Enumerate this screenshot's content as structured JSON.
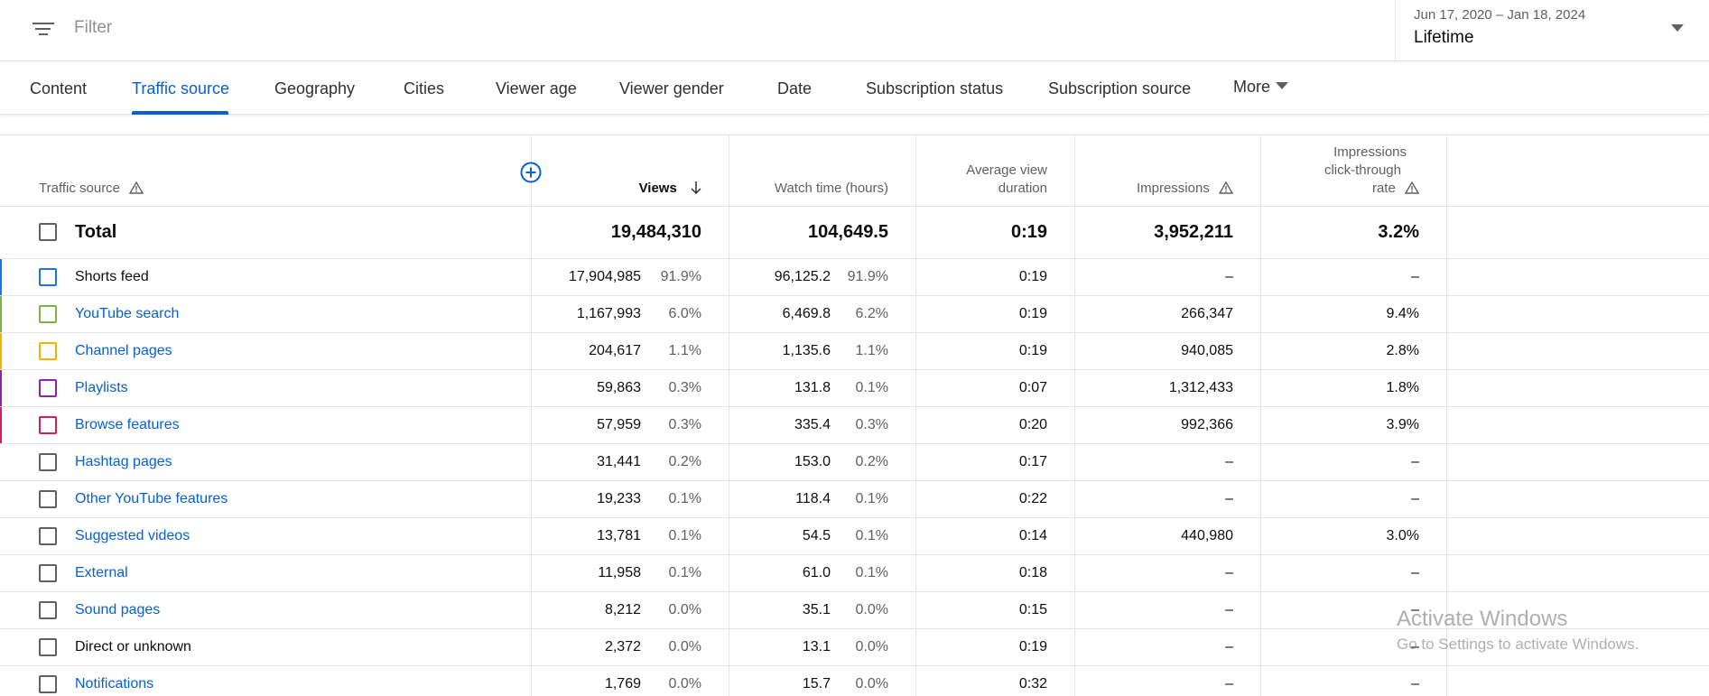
{
  "filter": {
    "placeholder": "Filter"
  },
  "date_range": {
    "dates": "Jun 17, 2020 – Jan 18, 2024",
    "label": "Lifetime"
  },
  "tabs": [
    {
      "label": "Content"
    },
    {
      "label": "Traffic source",
      "active": true
    },
    {
      "label": "Geography"
    },
    {
      "label": "Cities"
    },
    {
      "label": "Viewer age"
    },
    {
      "label": "Viewer gender"
    },
    {
      "label": "Date"
    },
    {
      "label": "Subscription status"
    },
    {
      "label": "Subscription source"
    },
    {
      "label": "More"
    }
  ],
  "columns": {
    "source": "Traffic source",
    "views": "Views",
    "watch_time": "Watch time (hours)",
    "avg_duration_1": "Average view",
    "avg_duration_2": "duration",
    "impressions": "Impressions",
    "ctr_1": "Impressions",
    "ctr_2": "click-through",
    "ctr_3": "rate"
  },
  "total": {
    "label": "Total",
    "views": "19,484,310",
    "watch_time": "104,649.5",
    "avg_duration": "0:19",
    "impressions": "3,952,211",
    "ctr": "3.2%"
  },
  "rows": [
    {
      "source": "Shorts feed",
      "link": false,
      "color": "#1a73e8",
      "views": "17,904,985",
      "views_pct": "91.9%",
      "watch": "96,125.2",
      "watch_pct": "91.9%",
      "avg": "0:19",
      "impressions": "–",
      "ctr": "–"
    },
    {
      "source": "YouTube search",
      "link": true,
      "color": "#7cb342",
      "views": "1,167,993",
      "views_pct": "6.0%",
      "watch": "6,469.8",
      "watch_pct": "6.2%",
      "avg": "0:19",
      "impressions": "266,347",
      "ctr": "9.4%"
    },
    {
      "source": "Channel pages",
      "link": true,
      "color": "#f4b400",
      "views": "204,617",
      "views_pct": "1.1%",
      "watch": "1,135.6",
      "watch_pct": "1.1%",
      "avg": "0:19",
      "impressions": "940,085",
      "ctr": "2.8%"
    },
    {
      "source": "Playlists",
      "link": true,
      "color": "#8e24aa",
      "views": "59,863",
      "views_pct": "0.3%",
      "watch": "131.8",
      "watch_pct": "0.1%",
      "avg": "0:07",
      "impressions": "1,312,433",
      "ctr": "1.8%"
    },
    {
      "source": "Browse features",
      "link": true,
      "color": "#d81b60",
      "views": "57,959",
      "views_pct": "0.3%",
      "watch": "335.4",
      "watch_pct": "0.3%",
      "avg": "0:20",
      "impressions": "992,366",
      "ctr": "3.9%"
    },
    {
      "source": "Hashtag pages",
      "link": true,
      "color": "",
      "views": "31,441",
      "views_pct": "0.2%",
      "watch": "153.0",
      "watch_pct": "0.2%",
      "avg": "0:17",
      "impressions": "–",
      "ctr": "–"
    },
    {
      "source": "Other YouTube features",
      "link": true,
      "color": "",
      "views": "19,233",
      "views_pct": "0.1%",
      "watch": "118.4",
      "watch_pct": "0.1%",
      "avg": "0:22",
      "impressions": "–",
      "ctr": "–"
    },
    {
      "source": "Suggested videos",
      "link": true,
      "color": "",
      "views": "13,781",
      "views_pct": "0.1%",
      "watch": "54.5",
      "watch_pct": "0.1%",
      "avg": "0:14",
      "impressions": "440,980",
      "ctr": "3.0%"
    },
    {
      "source": "External",
      "link": true,
      "color": "",
      "views": "11,958",
      "views_pct": "0.1%",
      "watch": "61.0",
      "watch_pct": "0.1%",
      "avg": "0:18",
      "impressions": "–",
      "ctr": "–"
    },
    {
      "source": "Sound pages",
      "link": true,
      "color": "",
      "views": "8,212",
      "views_pct": "0.0%",
      "watch": "35.1",
      "watch_pct": "0.0%",
      "avg": "0:15",
      "impressions": "–",
      "ctr": "–"
    },
    {
      "source": "Direct or unknown",
      "link": false,
      "color": "",
      "views": "2,372",
      "views_pct": "0.0%",
      "watch": "13.1",
      "watch_pct": "0.0%",
      "avg": "0:19",
      "impressions": "–",
      "ctr": "–"
    },
    {
      "source": "Notifications",
      "link": true,
      "color": "",
      "views": "1,769",
      "views_pct": "0.0%",
      "watch": "15.7",
      "watch_pct": "0.0%",
      "avg": "0:32",
      "impressions": "–",
      "ctr": "–"
    }
  ],
  "watermark": {
    "title": "Activate Windows",
    "subtitle": "Go to Settings to activate Windows."
  },
  "colors": {
    "accent": "#065fd4"
  }
}
